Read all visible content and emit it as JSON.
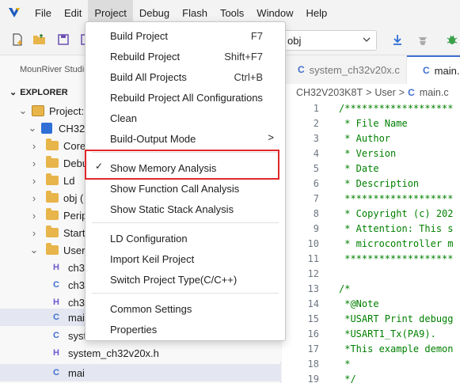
{
  "menubar": {
    "items": [
      "File",
      "Edit",
      "Project",
      "Debug",
      "Flash",
      "Tools",
      "Window",
      "Help"
    ],
    "active": "Project"
  },
  "toolbar": {
    "config_value": "obj"
  },
  "sidebar": {
    "tab_label": "MounRiver Studio",
    "explorer_title": "EXPLORER",
    "tree": [
      {
        "label": "Project:",
        "kind": "project"
      },
      {
        "label": "CH32V",
        "kind": "chip"
      },
      {
        "label": "Core",
        "kind": "folder"
      },
      {
        "label": "Debu",
        "kind": "folder"
      },
      {
        "label": "Ld",
        "kind": "folder"
      },
      {
        "label": "obj (",
        "kind": "folder"
      },
      {
        "label": "Perip",
        "kind": "folder"
      },
      {
        "label": "Startu",
        "kind": "folder"
      },
      {
        "label": "User",
        "kind": "folder"
      },
      {
        "label": "ch3",
        "kind": "h"
      },
      {
        "label": "ch3",
        "kind": "c"
      },
      {
        "label": "ch3",
        "kind": "h"
      },
      {
        "label": "mai",
        "kind": "c"
      },
      {
        "label": "syst",
        "kind": "c"
      },
      {
        "label": "system_ch32v20x.h",
        "kind": "h"
      }
    ]
  },
  "editor": {
    "tabs": [
      "system_ch32v20x.c",
      "main.c"
    ],
    "breadcrumb": {
      "part1": "CH32V203K8T",
      "sep": ">",
      "part2": "User",
      "part3": "main.c"
    },
    "lines": [
      {
        "n": "1",
        "t": "/*******************"
      },
      {
        "n": "2",
        "t": " * File Name"
      },
      {
        "n": "3",
        "t": " * Author"
      },
      {
        "n": "4",
        "t": " * Version"
      },
      {
        "n": "5",
        "t": " * Date"
      },
      {
        "n": "6",
        "t": " * Description"
      },
      {
        "n": "7",
        "t": " *******************"
      },
      {
        "n": "8",
        "t": " * Copyright (c) 202"
      },
      {
        "n": "9",
        "t": " * Attention: This s"
      },
      {
        "n": "10",
        "t": " * microcontroller m"
      },
      {
        "n": "11",
        "t": " *******************"
      },
      {
        "n": "12",
        "t": ""
      },
      {
        "n": "13",
        "t": "/*"
      },
      {
        "n": "14",
        "t": " *@Note"
      },
      {
        "n": "15",
        "t": " *USART Print debugg"
      },
      {
        "n": "16",
        "t": " *USART1_Tx(PA9)."
      },
      {
        "n": "17",
        "t": " *This example demon"
      },
      {
        "n": "18",
        "t": " *"
      },
      {
        "n": "19",
        "t": " */"
      }
    ]
  },
  "project_menu": {
    "items": [
      {
        "label": "Build Project",
        "shortcut": "F7"
      },
      {
        "label": "Rebuild Project",
        "shortcut": "Shift+F7"
      },
      {
        "label": "Build All Projects",
        "shortcut": "Ctrl+B"
      },
      {
        "label": "Rebuild Project All Configurations",
        "shortcut": ""
      },
      {
        "label": "Clean",
        "shortcut": ""
      },
      {
        "label": "Build-Output Mode",
        "shortcut": ""
      },
      {
        "label": "Show Memory Analysis",
        "shortcut": "",
        "checked": true
      },
      {
        "label": "Show Function Call Analysis",
        "shortcut": ""
      },
      {
        "label": "Show Static Stack Analysis",
        "shortcut": ""
      },
      {
        "label": "LD Configuration",
        "shortcut": ""
      },
      {
        "label": "Import Keil Project",
        "shortcut": ""
      },
      {
        "label": "Switch Project Type(C/C++)",
        "shortcut": ""
      },
      {
        "label": "Common Settings",
        "shortcut": ""
      },
      {
        "label": "Properties",
        "shortcut": ""
      }
    ],
    "check_glyph": "✓",
    "submenu_glyph": ">"
  },
  "colors": {
    "highlight_box": "#e0282b",
    "accent": "#3f6fd0",
    "comment": "#008000"
  }
}
